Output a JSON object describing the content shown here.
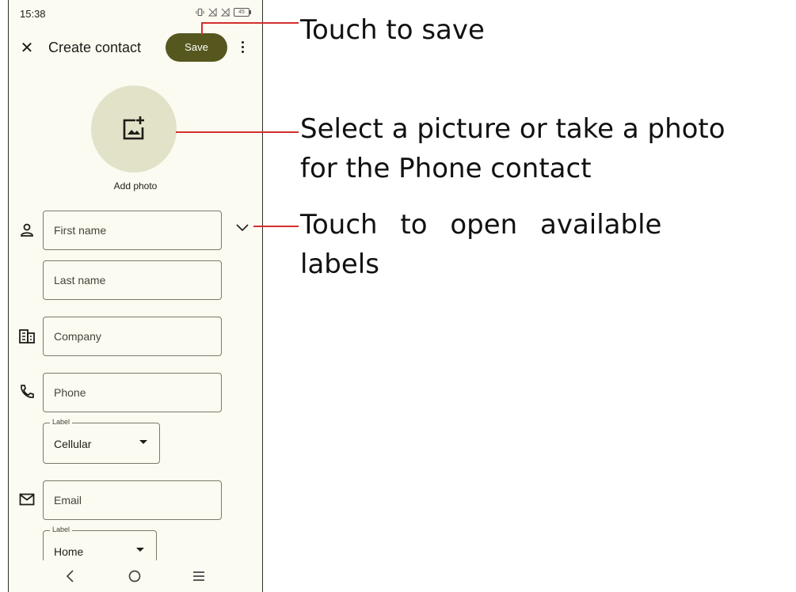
{
  "status_bar": {
    "time": "15:38",
    "battery": "45"
  },
  "app_bar": {
    "title": "Create contact",
    "save_label": "Save"
  },
  "photo": {
    "label": "Add photo"
  },
  "fields": {
    "first_name_placeholder": "First name",
    "last_name_placeholder": "Last name",
    "company_placeholder": "Company",
    "phone_placeholder": "Phone",
    "phone_label_caption": "Label",
    "phone_label_value": "Cellular",
    "email_placeholder": "Email",
    "email_label_caption": "Label",
    "email_label_value": "Home"
  },
  "icons": {
    "close": "close-icon",
    "more": "more-vert-icon",
    "add_photo": "add-photo-icon",
    "person": "person-icon",
    "company": "business-icon",
    "phone": "phone-icon",
    "email": "mail-icon",
    "expand": "chevron-down-icon",
    "nav_back": "back-icon",
    "nav_home": "home-icon",
    "nav_menu": "menu-icon"
  },
  "colors": {
    "save_button": "#56571e",
    "photo_circle": "#e1e2c8",
    "background": "#fcfbf2",
    "callout_line": "#d32f2f"
  },
  "annotations": {
    "save": "Touch to save",
    "photo_line1": "Select a picture or take a photo",
    "photo_line2": "for the Phone contact",
    "labels_line1": "Touch to open available",
    "labels_line2": "labels"
  }
}
